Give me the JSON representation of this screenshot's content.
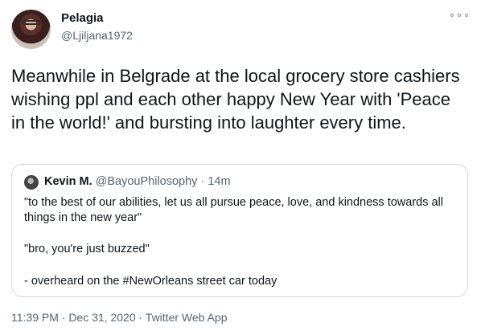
{
  "tweet": {
    "author_name": "Pelagia",
    "author_handle": "@Ljiljana1972",
    "text": "Meanwhile in Belgrade at the local grocery store cashiers wishing ppl and each other happy New Year with 'Peace in the world!' and bursting into laughter every time.",
    "footer": "11:39 PM · Dec 31, 2020 · Twitter Web App"
  },
  "quote": {
    "author_name": "Kevin M.",
    "author_handle": "@BayouPhilosophy",
    "time": "14m",
    "line1": "\"to the best of our abilities, let us all pursue peace, love, and kindness towards all things in the new year\"",
    "line2": "\"bro, you're just buzzed\"",
    "line3": "- overheard on the #NewOrleans street car today"
  },
  "icons": {
    "more": "more-horizontal-icon"
  }
}
